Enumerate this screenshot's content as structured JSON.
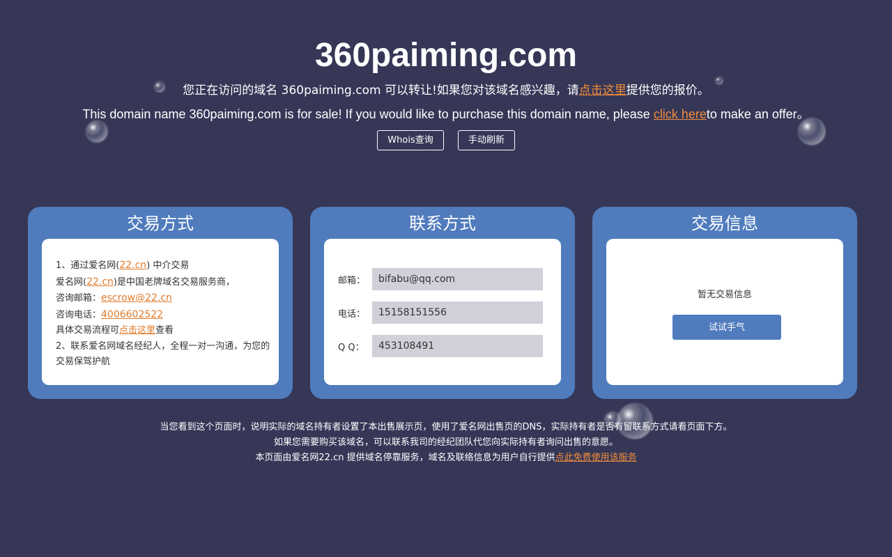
{
  "header": {
    "title": "360paiming.com",
    "cn_prefix": "您正在访问的域名 360paiming.com 可以转让!如果您对该域名感兴趣，请",
    "cn_link": "点击这里",
    "cn_suffix": "提供您的报价。",
    "en_prefix": "This domain name 360paiming.com is for sale! If you would like to purchase this domain name, please ",
    "en_link": "click here",
    "en_suffix": "to make an offer。",
    "whois_button": "Whois查询",
    "refresh_button": "手动刷新"
  },
  "trade_method": {
    "title": "交易方式",
    "line1_prefix": "1、通过爱名网(",
    "line1_link": "22.cn",
    "line1_suffix": ") 中介交易",
    "line2_prefix": "爱名网(",
    "line2_link": "22.cn",
    "line2_suffix": ")是中国老牌域名交易服务商，",
    "email_label": "咨询邮箱：",
    "email_link": "escrow@22.cn",
    "phone_label": "咨询电话：",
    "phone_link": "4006602522",
    "process_prefix": "具体交易流程可",
    "process_link": "点击这里",
    "process_suffix": "查看",
    "line_broker": "2、联系爱名网域名经纪人，全程一对一沟通，为您的交易保驾护航"
  },
  "contact": {
    "title": "联系方式",
    "email_label": "邮箱：",
    "email_value": "bifabu@qq.com",
    "phone_label": "电话：",
    "phone_value": "15158151556",
    "qq_label": "Q Q：",
    "qq_value": "453108491"
  },
  "trade_info": {
    "title": "交易信息",
    "empty_text": "暂无交易信息",
    "try_button": "试试手气"
  },
  "footer": {
    "line1": "当您看到这个页面时，说明实际的域名持有者设置了本出售展示页，使用了爱名网出售页的DNS，实际持有者是否有留联系方式请看页面下方。",
    "line2": "如果您需要购买该域名，可以联系我司的经纪团队代您向实际持有者询问出售的意愿。",
    "line3_prefix": "本页面由爱名网22.cn 提供域名停靠服务，域名及联络信息为用户自行提供",
    "line3_link": "点此免费使用该服务"
  },
  "colors": {
    "background": "#363757",
    "card": "#507cbd",
    "link": "#f08c3a"
  }
}
